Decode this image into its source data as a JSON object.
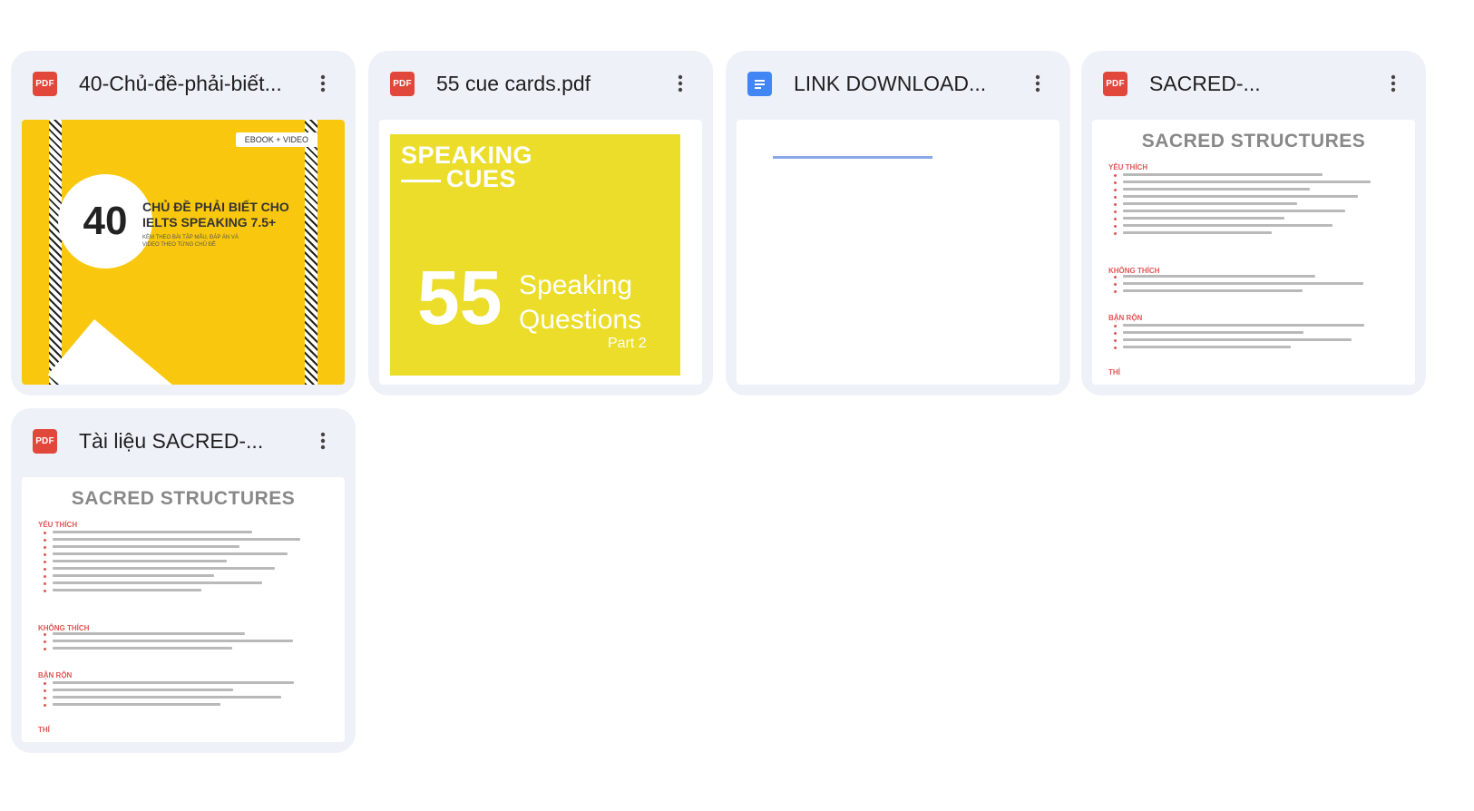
{
  "files": [
    {
      "title": "40-Chủ-đề-phải-biết...",
      "type": "pdf",
      "icon": "pdf-file-icon",
      "type_label": "PDF",
      "thumb": {
        "badge": "EBOOK + VIDEO",
        "number": "40",
        "line1": "CHỦ ĐỀ PHẢI BIẾT CHO",
        "line2": "IELTS SPEAKING 7.5+",
        "line3": "KÈM THEO BÀI TẬP MẪU, ĐÁP ÁN VÀ",
        "line4": "VIDEO THEO TỪNG CHỦ ĐỀ"
      }
    },
    {
      "title": "55 cue cards.pdf",
      "type": "pdf",
      "icon": "pdf-file-icon",
      "type_label": "PDF",
      "thumb": {
        "heading1": "SPEAKING",
        "heading2": "CUES",
        "number": "55",
        "word1": "Speaking",
        "word2": "Questions",
        "part": "Part 2"
      }
    },
    {
      "title": "LINK DOWNLOAD...",
      "type": "doc",
      "icon": "docs-file-icon"
    },
    {
      "title": "SACRED-...",
      "type": "pdf",
      "icon": "pdf-file-icon",
      "type_label": "PDF",
      "thumb": {
        "heading": "SACRED STRUCTURES",
        "s1": "YÊU THÍCH",
        "s2": "KHÔNG THÍCH",
        "s3": "BẬN RỘN",
        "s4": "THÍ"
      }
    },
    {
      "title": "Tài liệu SACRED-...",
      "type": "pdf",
      "icon": "pdf-file-icon",
      "type_label": "PDF",
      "thumb": {
        "heading": "SACRED STRUCTURES",
        "s1": "YÊU THÍCH",
        "s2": "KHÔNG THÍCH",
        "s3": "BẬN RỘN",
        "s4": "THÍ"
      }
    }
  ],
  "more_icon": "more-vert-icon",
  "colors": {
    "card_bg": "#eef2f8",
    "pdf_red": "#e2473b",
    "docs_blue": "#4285f4"
  }
}
